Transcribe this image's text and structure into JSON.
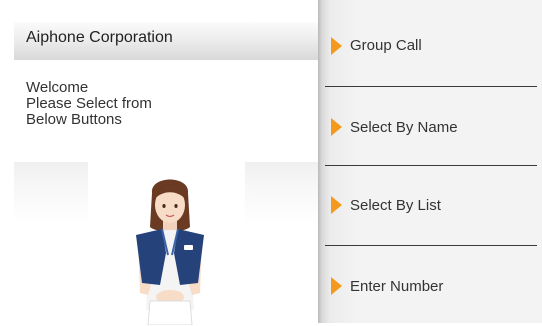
{
  "header": {
    "company_name": "Aiphone Corporation"
  },
  "welcome": {
    "lines": [
      "Welcome",
      "Please Select from",
      "Below Buttons"
    ]
  },
  "menu": {
    "items": [
      {
        "label": "Group Call",
        "icon": "orange-triangle-arrow"
      },
      {
        "label": "Select By Name",
        "icon": "orange-triangle-arrow"
      },
      {
        "label": "Select By List",
        "icon": "orange-triangle-arrow"
      },
      {
        "label": "Enter Number",
        "icon": "orange-triangle-arrow"
      }
    ]
  },
  "colors": {
    "accent_arrow": "#f39a1e",
    "menu_background": "#f3f3f3",
    "vest": "#25427a"
  }
}
